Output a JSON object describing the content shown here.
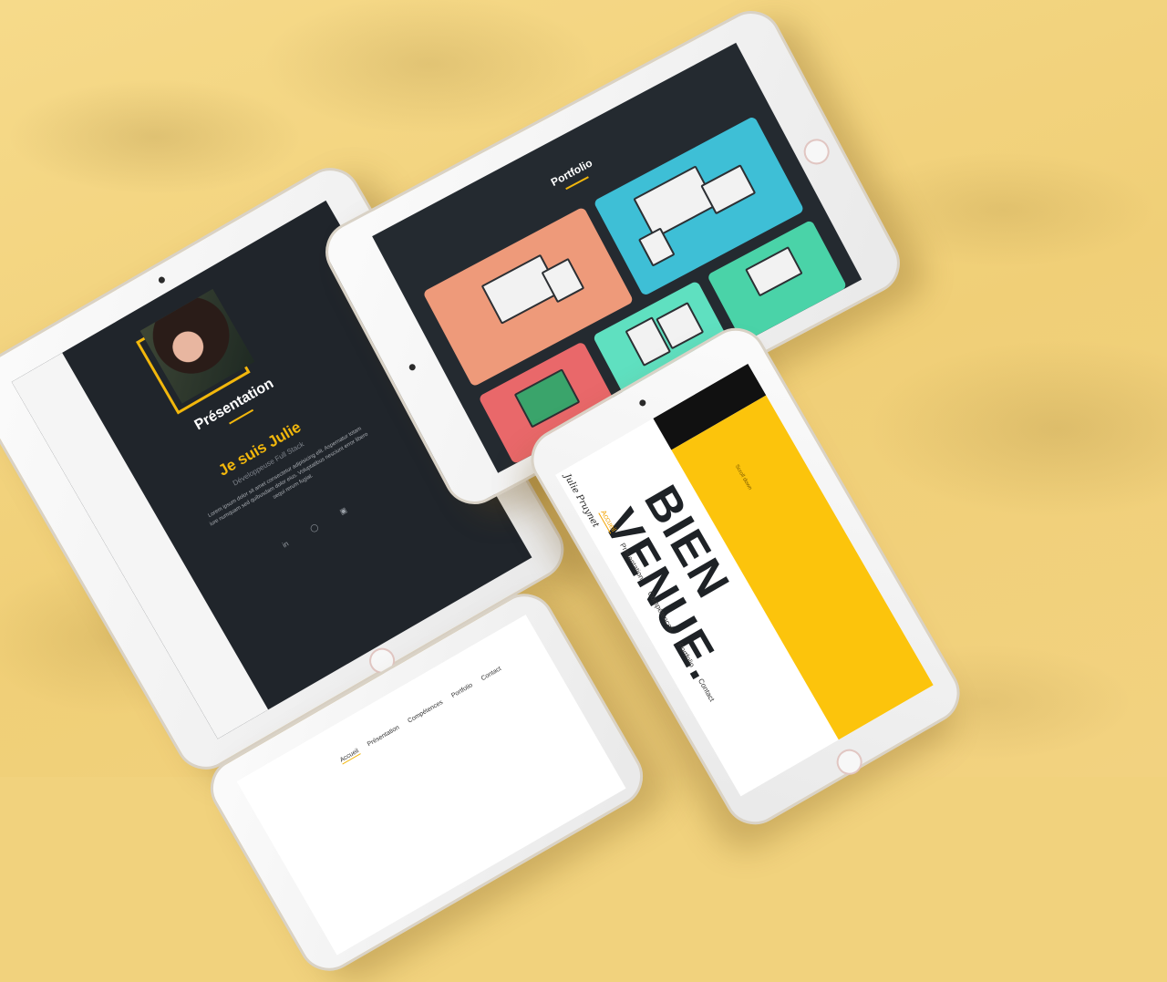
{
  "presentation": {
    "section_title": "Présentation",
    "name": "Je suis Julie",
    "role": "Développeuse Full Stack",
    "body": "Lorem ipsum dolor sit amet consectetur adipisicing elit. Aspernatur totam iure numquam sed quibusdam dolor eius. Voluptatibus nesciunt error libero sequi rerum fugiat.",
    "social_icons": [
      "linkedin-icon",
      "github-icon",
      "instagram-icon"
    ]
  },
  "portfolio": {
    "title": "Portfolio",
    "tile_colors": [
      "#ee9a7a",
      "#3ebfd6",
      "#5fe0c0",
      "#e9686a",
      "#4ad3a8"
    ]
  },
  "bienvenue": {
    "signature": "Julie Pruynet",
    "headline_1": "BIEN",
    "headline_2": "VENUE.",
    "scroll_label": "Scroll down",
    "nav": [
      "Accueil",
      "Présentation",
      "Compétences",
      "Portfolio",
      "Contact"
    ],
    "accent_color": "#fcc40c"
  },
  "homepage": {
    "nav": [
      "Accueil",
      "Présentation",
      "Compétences",
      "Portfolio",
      "Contact"
    ]
  }
}
